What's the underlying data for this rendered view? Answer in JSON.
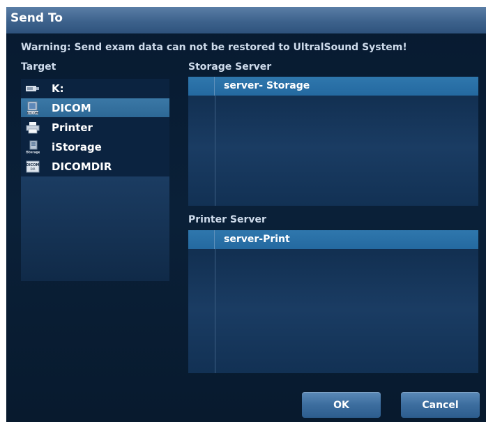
{
  "dialog": {
    "title": "Send To",
    "warning": "Warning: Send exam data can not be restored to UltralSound System!"
  },
  "target": {
    "label": "Target",
    "items": [
      {
        "label": "K:",
        "icon": "usb-drive-icon",
        "selected": false
      },
      {
        "label": "DICOM",
        "icon": "dicom-icon",
        "selected": true
      },
      {
        "label": "Printer",
        "icon": "printer-icon",
        "selected": false
      },
      {
        "label": "iStorage",
        "icon": "istorage-icon",
        "selected": false
      },
      {
        "label": "DICOMDIR",
        "icon": "dicomdir-icon",
        "selected": false
      }
    ]
  },
  "storage_server": {
    "label": "Storage Server",
    "rows": [
      "server- Storage"
    ]
  },
  "printer_server": {
    "label": "Printer Server",
    "rows": [
      "server-Print"
    ]
  },
  "buttons": {
    "ok": "OK",
    "cancel": "Cancel"
  },
  "colors": {
    "title_bar": "#3d628c",
    "background": "#0a2038",
    "selection": "#2f77ad",
    "text": "#ffffff"
  }
}
